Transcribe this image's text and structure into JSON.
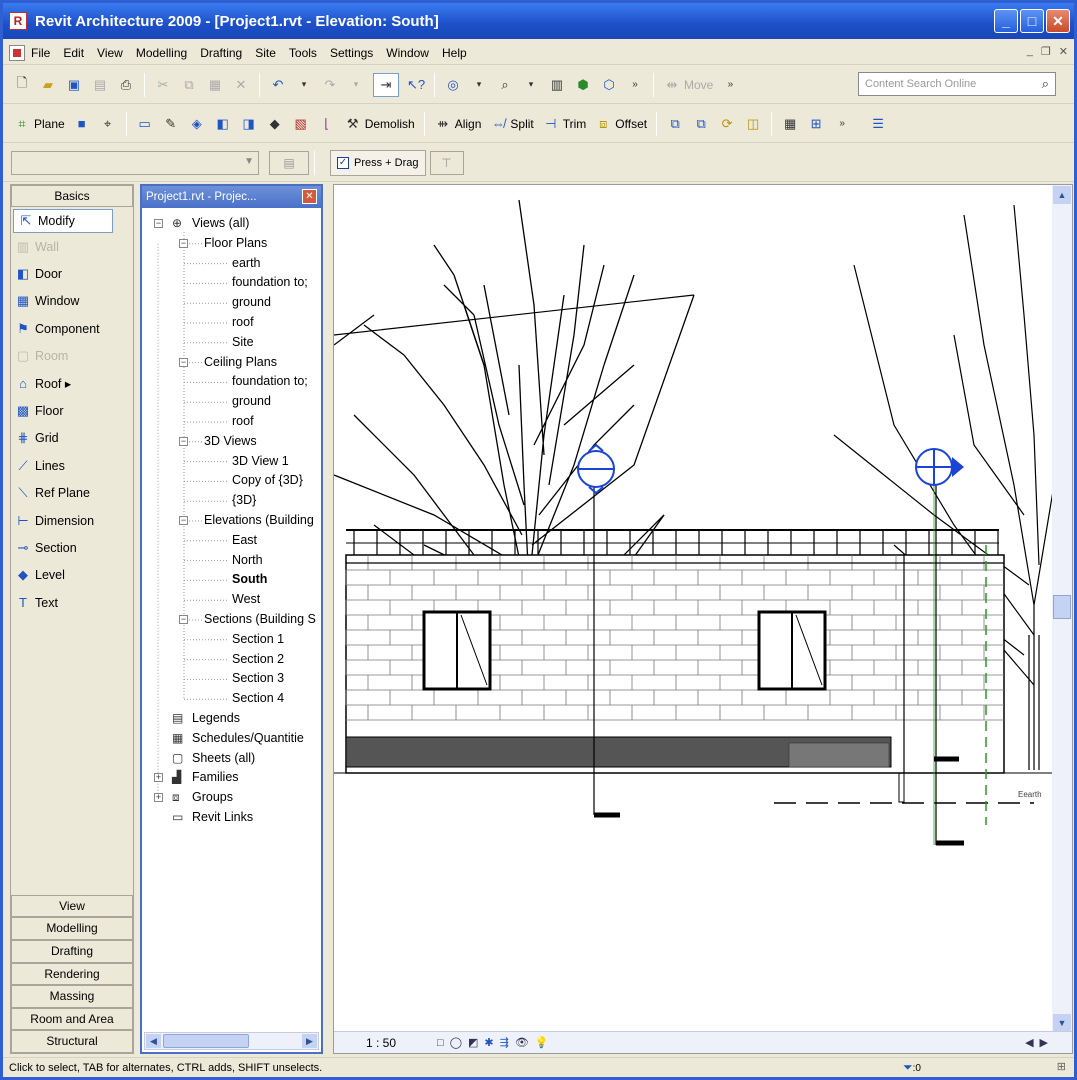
{
  "window": {
    "title": "Revit Architecture 2009 - [Project1.rvt - Elevation: South]"
  },
  "menu": [
    "File",
    "Edit",
    "View",
    "Modelling",
    "Drafting",
    "Site",
    "Tools",
    "Settings",
    "Window",
    "Help"
  ],
  "toolbar1": {
    "move_label": "Move",
    "search_placeholder": "Content Search Online"
  },
  "toolbar2": {
    "plane": "Plane",
    "demolish": "Demolish",
    "align": "Align",
    "split": "Split",
    "trim": "Trim",
    "offset": "Offset"
  },
  "options_bar": {
    "press_drag": "Press + Drag",
    "press_drag_checked": true
  },
  "design_bar": {
    "top_tab": "Basics",
    "items": [
      {
        "label": "Modify",
        "icon": "cursor-arrow-icon",
        "state": "active"
      },
      {
        "label": "Wall",
        "icon": "wall-icon",
        "state": "disabled"
      },
      {
        "label": "Door",
        "icon": "door-icon",
        "state": "normal"
      },
      {
        "label": "Window",
        "icon": "window-icon",
        "state": "normal"
      },
      {
        "label": "Component",
        "icon": "component-icon",
        "state": "normal"
      },
      {
        "label": "Room",
        "icon": "room-icon",
        "state": "disabled"
      },
      {
        "label": "Roof ▸",
        "icon": "roof-icon",
        "state": "normal"
      },
      {
        "label": "Floor",
        "icon": "floor-icon",
        "state": "normal"
      },
      {
        "label": "Grid",
        "icon": "grid-icon",
        "state": "normal"
      },
      {
        "label": "Lines",
        "icon": "lines-icon",
        "state": "normal"
      },
      {
        "label": "Ref Plane",
        "icon": "ref-plane-icon",
        "state": "normal"
      },
      {
        "label": "Dimension",
        "icon": "dimension-icon",
        "state": "normal"
      },
      {
        "label": "Section",
        "icon": "section-icon",
        "state": "normal"
      },
      {
        "label": "Level",
        "icon": "level-icon",
        "state": "normal"
      },
      {
        "label": "Text",
        "icon": "text-icon",
        "state": "normal"
      }
    ],
    "bottom_tabs": [
      "View",
      "Modelling",
      "Drafting",
      "Rendering",
      "Massing",
      "Room and Area",
      "Structural"
    ]
  },
  "project_browser": {
    "title": "Project1.rvt - Projec...",
    "nodes": [
      {
        "label": "Views (all)",
        "level": 0,
        "expander": "−",
        "icon": "views-icon"
      },
      {
        "label": "Floor Plans",
        "level": 1,
        "expander": "−"
      },
      {
        "label": "earth",
        "level": 2
      },
      {
        "label": "foundation to;",
        "level": 2
      },
      {
        "label": "ground",
        "level": 2
      },
      {
        "label": "roof",
        "level": 2
      },
      {
        "label": "Site",
        "level": 2
      },
      {
        "label": "Ceiling Plans",
        "level": 1,
        "expander": "−"
      },
      {
        "label": "foundation to;",
        "level": 2
      },
      {
        "label": "ground",
        "level": 2
      },
      {
        "label": "roof",
        "level": 2
      },
      {
        "label": "3D Views",
        "level": 1,
        "expander": "−"
      },
      {
        "label": "3D View 1",
        "level": 2
      },
      {
        "label": "Copy of {3D}",
        "level": 2
      },
      {
        "label": "{3D}",
        "level": 2
      },
      {
        "label": "Elevations (Building",
        "level": 1,
        "expander": "−"
      },
      {
        "label": "East",
        "level": 2
      },
      {
        "label": "North",
        "level": 2
      },
      {
        "label": "South",
        "level": 2,
        "bold": true
      },
      {
        "label": "West",
        "level": 2
      },
      {
        "label": "Sections (Building S",
        "level": 1,
        "expander": "−"
      },
      {
        "label": "Section 1",
        "level": 2
      },
      {
        "label": "Section 2",
        "level": 2
      },
      {
        "label": "Section 3",
        "level": 2
      },
      {
        "label": "Section 4",
        "level": 2
      },
      {
        "label": "Legends",
        "level": 0,
        "icon": "legends-icon"
      },
      {
        "label": "Schedules/Quantitie",
        "level": 0,
        "icon": "schedules-icon"
      },
      {
        "label": "Sheets (all)",
        "level": 0,
        "icon": "sheets-icon"
      },
      {
        "label": "Families",
        "level": 0,
        "expander": "+",
        "icon": "families-icon"
      },
      {
        "label": "Groups",
        "level": 0,
        "expander": "+",
        "icon": "groups-icon"
      },
      {
        "label": "Revit Links",
        "level": 0,
        "icon": "revit-links-icon"
      }
    ]
  },
  "view": {
    "scale": "1 : 50",
    "level_tag": "Eearth"
  },
  "status": {
    "hint": "Click to select, TAB for alternates, CTRL adds, SHIFT unselects.",
    "filter_count": ":0"
  }
}
